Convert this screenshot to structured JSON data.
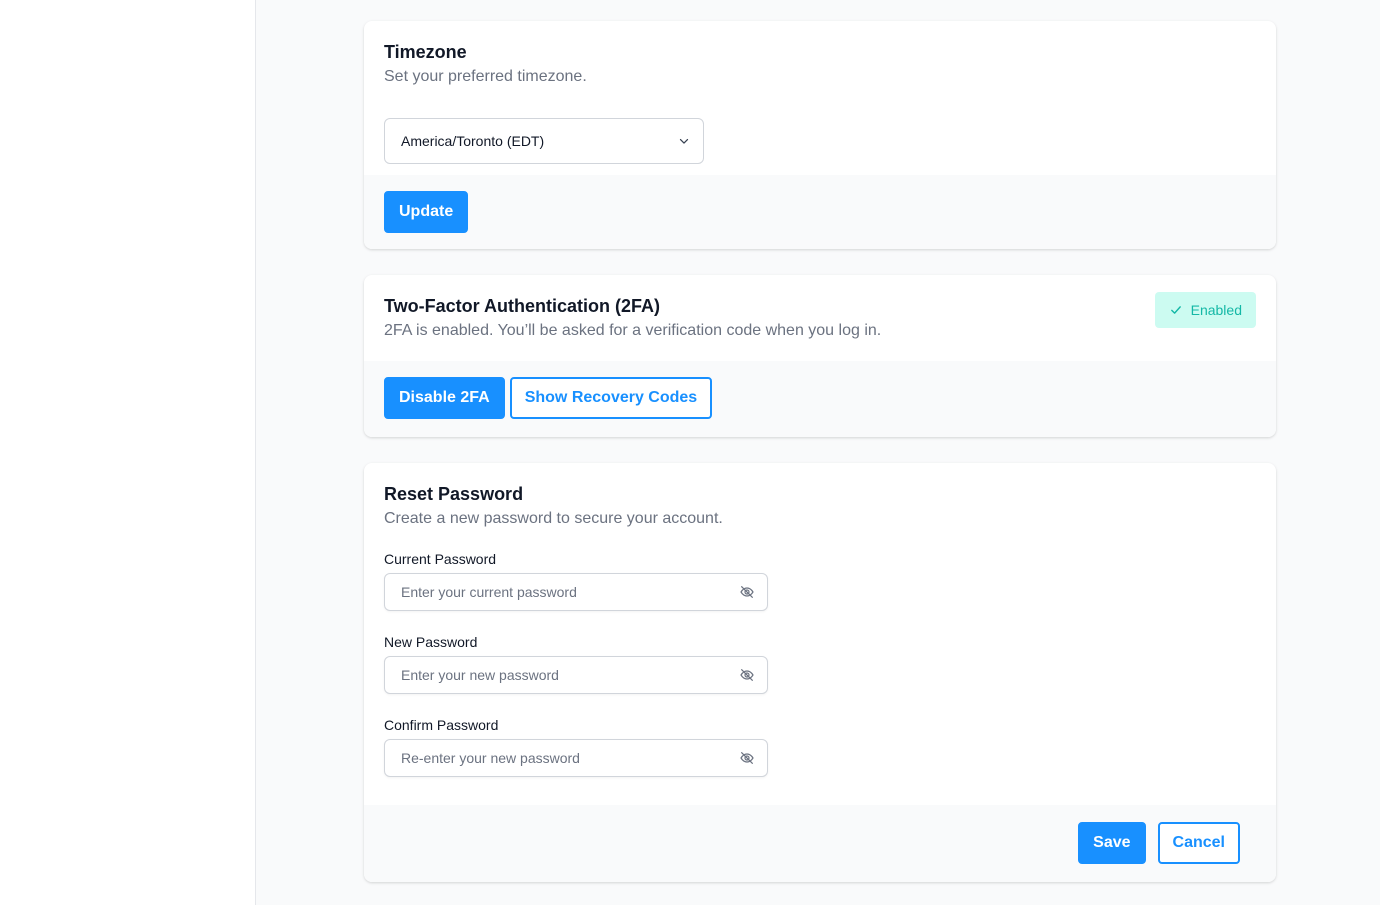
{
  "timezone": {
    "title": "Timezone",
    "description": "Set your preferred timezone.",
    "selected": "America/Toronto (EDT)",
    "update_label": "Update"
  },
  "two_factor": {
    "title": "Two-Factor Authentication (2FA)",
    "description": "2FA is enabled. You’ll be asked for a verification code when you log in.",
    "status_label": "Enabled",
    "status_color": "#14b8a6",
    "disable_label": "Disable 2FA",
    "recovery_label": "Show Recovery Codes"
  },
  "reset_password": {
    "title": "Reset Password",
    "description": "Create a new password to secure your account.",
    "fields": [
      {
        "label": "Current Password",
        "placeholder": "Enter your current password",
        "value": ""
      },
      {
        "label": "New Password",
        "placeholder": "Enter your new password",
        "value": ""
      },
      {
        "label": "Confirm Password",
        "placeholder": "Re-enter your new password",
        "value": ""
      }
    ],
    "save_label": "Save",
    "cancel_label": "Cancel"
  },
  "colors": {
    "primary": "#1890ff",
    "badge_bg": "#ccfbf1"
  },
  "icons": {
    "select": "chevron-down-icon",
    "badge": "check-icon",
    "password_toggle": "eye-off-icon"
  }
}
